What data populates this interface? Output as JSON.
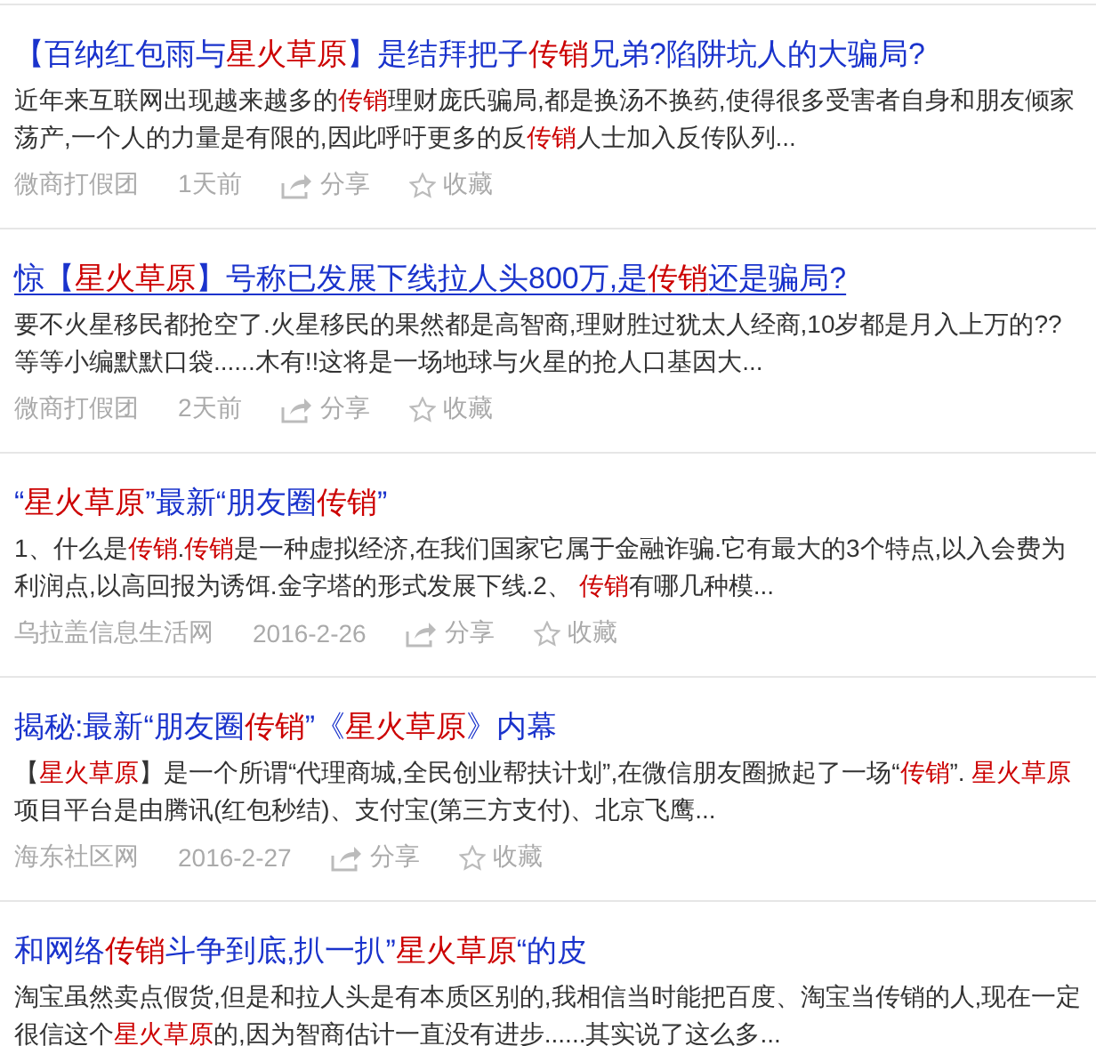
{
  "results": [
    {
      "title": [
        {
          "text": "【百纳红包雨与",
          "hl": false
        },
        {
          "text": "星火草原",
          "hl": true
        },
        {
          "text": "】是结拜把子",
          "hl": false
        },
        {
          "text": "传销",
          "hl": true
        },
        {
          "text": "兄弟?陷阱坑人的大骗局?",
          "hl": false
        }
      ],
      "hovered": false,
      "snippet": [
        {
          "text": "近年来互联网出现越来越多的",
          "hl": false
        },
        {
          "text": "传销",
          "hl": true
        },
        {
          "text": "理财庞氏骗局,都是换汤不换药,使得很多受害者自身和朋友倾家荡产,一个人的力量是有限的,因此呼吁更多的反",
          "hl": false
        },
        {
          "text": "传销",
          "hl": true
        },
        {
          "text": "人士加入反传队列...",
          "hl": false
        }
      ],
      "source": "微商打假团",
      "time": "1天前",
      "share": "分享",
      "favorite": "收藏"
    },
    {
      "title": [
        {
          "text": "惊【",
          "hl": false
        },
        {
          "text": "星火草原",
          "hl": true
        },
        {
          "text": "】号称已发展下线拉人头800万,是",
          "hl": false
        },
        {
          "text": "传销",
          "hl": true
        },
        {
          "text": "还是骗局?",
          "hl": false
        }
      ],
      "hovered": true,
      "snippet": [
        {
          "text": "要不火星移民都抢空了.火星移民的果然都是高智商,理财胜过犹太人经商,10岁都是月入上万的??等等小编默默口袋......木有!!这将是一场地球与火星的抢人口基因大...",
          "hl": false
        }
      ],
      "source": "微商打假团",
      "time": "2天前",
      "share": "分享",
      "favorite": "收藏"
    },
    {
      "title": [
        {
          "text": "“",
          "hl": false
        },
        {
          "text": "星火草原",
          "hl": true
        },
        {
          "text": "”最新“朋友圈",
          "hl": false
        },
        {
          "text": "传销",
          "hl": true
        },
        {
          "text": "”",
          "hl": false
        }
      ],
      "hovered": false,
      "snippet": [
        {
          "text": "1、什么是",
          "hl": false
        },
        {
          "text": "传销",
          "hl": true
        },
        {
          "text": ".",
          "hl": false
        },
        {
          "text": "传销",
          "hl": true
        },
        {
          "text": "是一种虚拟经济,在我们国家它属于金融诈骗.它有最大的3个特点,以入会费为利润点,以高回报为诱饵.金字塔的形式发展下线.2、 ",
          "hl": false
        },
        {
          "text": "传销",
          "hl": true
        },
        {
          "text": "有哪几种模...",
          "hl": false
        }
      ],
      "source": "乌拉盖信息生活网",
      "time": "2016-2-26",
      "share": "分享",
      "favorite": "收藏"
    },
    {
      "title": [
        {
          "text": "揭秘:最新“朋友圈",
          "hl": false
        },
        {
          "text": "传销",
          "hl": true
        },
        {
          "text": "”《",
          "hl": false
        },
        {
          "text": "星火草原",
          "hl": true
        },
        {
          "text": "》内幕",
          "hl": false
        }
      ],
      "hovered": false,
      "snippet": [
        {
          "text": "【",
          "hl": false
        },
        {
          "text": "星火草原",
          "hl": true
        },
        {
          "text": "】是一个所谓“代理商城,全民创业帮扶计划”,在微信朋友圈掀起了一场“",
          "hl": false
        },
        {
          "text": "传销",
          "hl": true
        },
        {
          "text": "”. ",
          "hl": false
        },
        {
          "text": "星火草原",
          "hl": true
        },
        {
          "text": "项目平台是由腾讯(红包秒结)、支付宝(第三方支付)、北京飞鹰...",
          "hl": false
        }
      ],
      "source": "海东社区网",
      "time": "2016-2-27",
      "share": "分享",
      "favorite": "收藏"
    },
    {
      "title": [
        {
          "text": "和网络",
          "hl": false
        },
        {
          "text": "传销",
          "hl": true
        },
        {
          "text": "斗争到底,扒一扒”",
          "hl": false
        },
        {
          "text": "星火草原",
          "hl": true
        },
        {
          "text": "“的皮",
          "hl": false
        }
      ],
      "hovered": false,
      "snippet": [
        {
          "text": "淘宝虽然卖点假货,但是和拉人头是有本质区别的,我相信当时能把百度、淘宝当传销的人,现在一定很信这个",
          "hl": false
        },
        {
          "text": "星火草原",
          "hl": true
        },
        {
          "text": "的,因为智商估计一直没有进步......其实说了这么多...",
          "hl": false
        }
      ]
    }
  ]
}
